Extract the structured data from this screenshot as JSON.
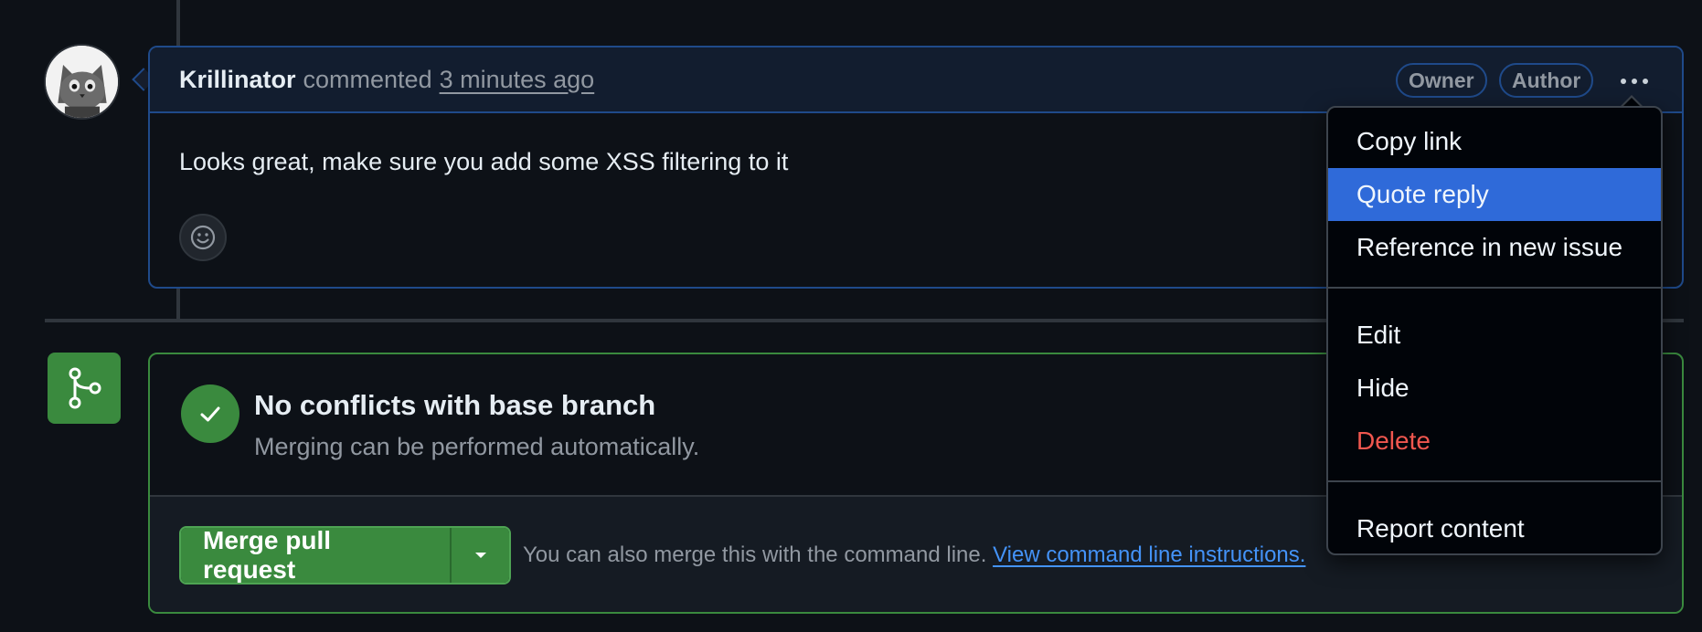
{
  "comment": {
    "author": "Krillinator",
    "action": "commented",
    "time": "3 minutes ago",
    "badges": [
      "Owner",
      "Author"
    ],
    "body": "Looks great, make sure you add some XSS filtering to it"
  },
  "merge": {
    "title": "No conflicts with base branch",
    "subtitle": "Merging can be performed automatically.",
    "button_label": "Merge pull request",
    "hint": "You can also merge this with the command line.",
    "hint_link": "View command line instructions."
  },
  "menu": {
    "items": [
      {
        "label": "Copy link"
      },
      {
        "label": "Quote reply",
        "state": "highlighted"
      },
      {
        "label": "Reference in new issue"
      },
      {
        "label": "Edit"
      },
      {
        "label": "Hide"
      },
      {
        "label": "Delete",
        "style": "danger"
      },
      {
        "label": "Report content"
      }
    ]
  },
  "colors": {
    "background": "#0d1117",
    "accent_blue": "#2f6ad9",
    "success_green": "#3a8a3e",
    "danger_red": "#f0574f",
    "link_blue": "#4493f8"
  },
  "icons": {
    "avatar": "cat-avatar",
    "kebab": "kebab-horizontal-icon",
    "emoji": "smiley-icon",
    "merge": "git-branch-icon",
    "check": "check-icon",
    "caret": "triangle-down-icon"
  }
}
